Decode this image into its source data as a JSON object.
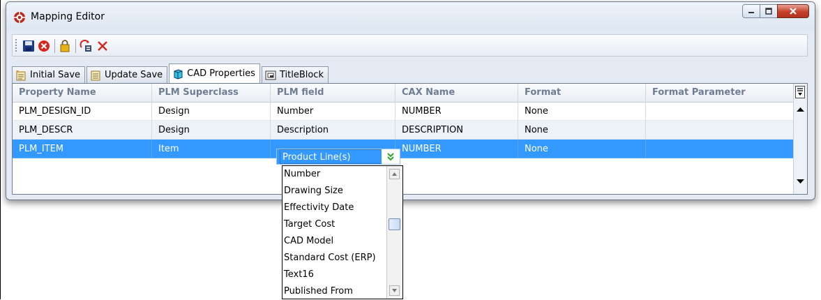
{
  "window": {
    "title": "Mapping Editor",
    "controls": {
      "minimize": "minimize-icon",
      "maximize": "maximize-icon",
      "close": "close-icon"
    }
  },
  "toolbar": {
    "items": [
      "save-icon",
      "cancel-icon",
      "lock-icon",
      "refresh-mapping-icon",
      "delete-icon"
    ]
  },
  "tabs": [
    {
      "label": "Initial Save",
      "icon": "initial-save-icon",
      "active": false
    },
    {
      "label": "Update Save",
      "icon": "update-save-icon",
      "active": false
    },
    {
      "label": "CAD Properties",
      "icon": "cube-icon",
      "active": true
    },
    {
      "label": "TitleBlock",
      "icon": "titleblock-icon",
      "active": false
    }
  ],
  "grid": {
    "columns": [
      "Property Name",
      "PLM Superclass",
      "PLM field",
      "CAX Name",
      "Format",
      "Format Parameter"
    ],
    "rows": [
      [
        "PLM_DESIGN_ID",
        "Design",
        "Number",
        "NUMBER",
        "None",
        ""
      ],
      [
        "PLM_DESCR",
        "Design",
        "Description",
        "DESCRIPTION",
        "None",
        ""
      ],
      [
        "PLM_ITEM",
        "Item",
        "Product Line(s)",
        "NUMBER",
        "None",
        ""
      ]
    ],
    "selected_row": 2
  },
  "combo": {
    "value": "Product Line(s)"
  },
  "dropdown": {
    "options": [
      "Number",
      "Drawing Size",
      "Effectivity Date",
      "Target Cost",
      "CAD Model",
      "Standard Cost (ERP)",
      "Text16",
      "Published From"
    ]
  },
  "colors": {
    "selection": "#3399ff",
    "header_text": "#6f7d93",
    "window_bg": "#e3eaf4"
  }
}
